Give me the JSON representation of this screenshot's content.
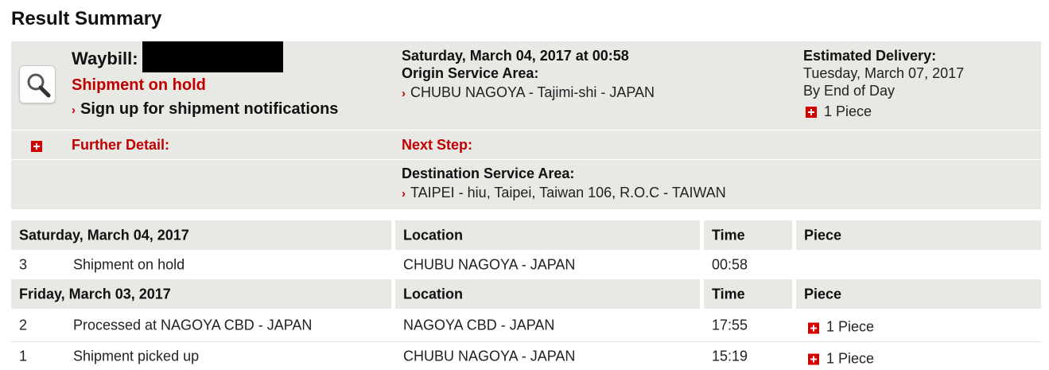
{
  "page_title": "Result Summary",
  "summary": {
    "waybill_label": "Waybill:",
    "status": "Shipment on hold",
    "signup_link": "Sign up for shipment notifications",
    "event_datetime": "Saturday, March 04, 2017 at 00:58",
    "origin_label": "Origin Service Area:",
    "origin_value": "CHUBU NAGOYA - Tajimi-shi - JAPAN",
    "estimated_label": "Estimated Delivery:",
    "estimated_date": "Tuesday, March 07, 2017",
    "estimated_time": "By End of Day",
    "pieces": "1 Piece",
    "further_detail_label": "Further Detail:",
    "next_step_label": "Next Step:",
    "destination_label": "Destination Service Area:",
    "destination_value": "TAIPEI - hiu, Taipei, Taiwan 106, R.O.C - TAIWAN"
  },
  "events": [
    {
      "date": "Saturday, March 04, 2017",
      "location_header": "Location",
      "time_header": "Time",
      "piece_header": "Piece",
      "rows": [
        {
          "num": "3",
          "desc": "Shipment on hold",
          "location": "CHUBU NAGOYA - JAPAN",
          "time": "00:58",
          "piece": ""
        }
      ]
    },
    {
      "date": "Friday, March 03, 2017",
      "location_header": "Location",
      "time_header": "Time",
      "piece_header": "Piece",
      "rows": [
        {
          "num": "2",
          "desc": "Processed at NAGOYA CBD - JAPAN",
          "location": "NAGOYA CBD - JAPAN",
          "time": "17:55",
          "piece": "1 Piece"
        },
        {
          "num": "1",
          "desc": "Shipment picked up",
          "location": "CHUBU NAGOYA - JAPAN",
          "time": "15:19",
          "piece": "1 Piece"
        }
      ]
    }
  ],
  "colors": {
    "accent_red": "#c00000",
    "panel_bg": "#e8e8e4"
  },
  "icons": [
    "magnifier-icon",
    "chevron-right-icon",
    "plus-icon"
  ]
}
